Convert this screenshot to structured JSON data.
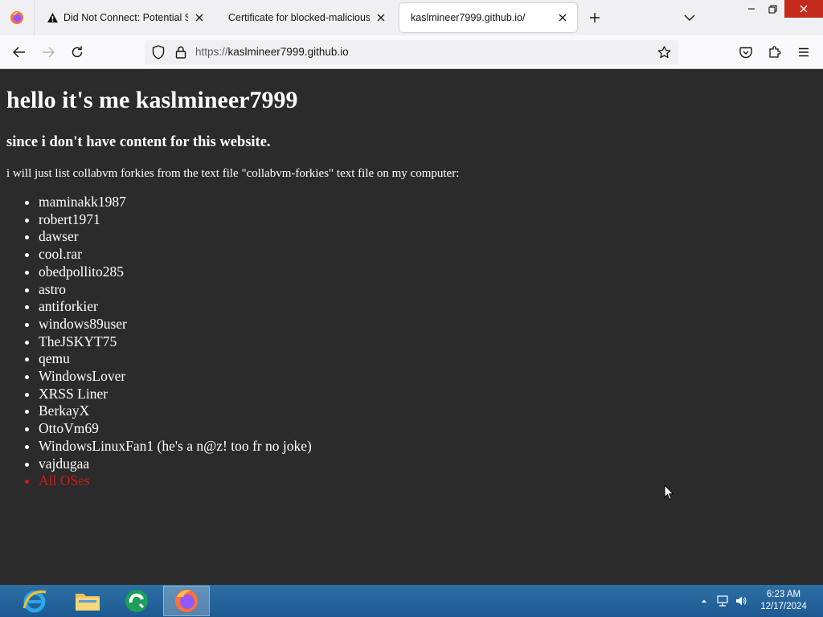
{
  "browser": {
    "tabs": [
      {
        "title": "Did Not Connect: Potential Sec",
        "icon": "warning-icon"
      },
      {
        "title": "Certificate for blocked-malicious.co",
        "icon": ""
      },
      {
        "title": "kaslmineer7999.github.io/",
        "icon": "",
        "active": true
      }
    ],
    "url_scheme": "https://",
    "url_host": "kaslmineer7999.github.io"
  },
  "page": {
    "heading": "hello it's me kaslmineer7999",
    "subheading": "since i don't have content for this website.",
    "intro": "i will just list collabvm forkies from the text file \"collabvm-forkies\" text file on my computer:",
    "list": [
      "maminakk1987",
      "robert1971",
      "dawser",
      "cool.rar",
      "obedpollito285",
      "astro",
      "antiforkier",
      "windows89user",
      "TheJSKYT75",
      "qemu",
      "WindowsLover",
      "XRSS Liner",
      "BerkayX",
      "OttoVm69",
      "WindowsLinuxFan1 (he's a n@z! too fr no joke)",
      "vajdugaa",
      "All OSes"
    ],
    "highlight_color": "#d41919"
  },
  "taskbar": {
    "time": "6:23 AM",
    "date": "12/17/2024"
  }
}
